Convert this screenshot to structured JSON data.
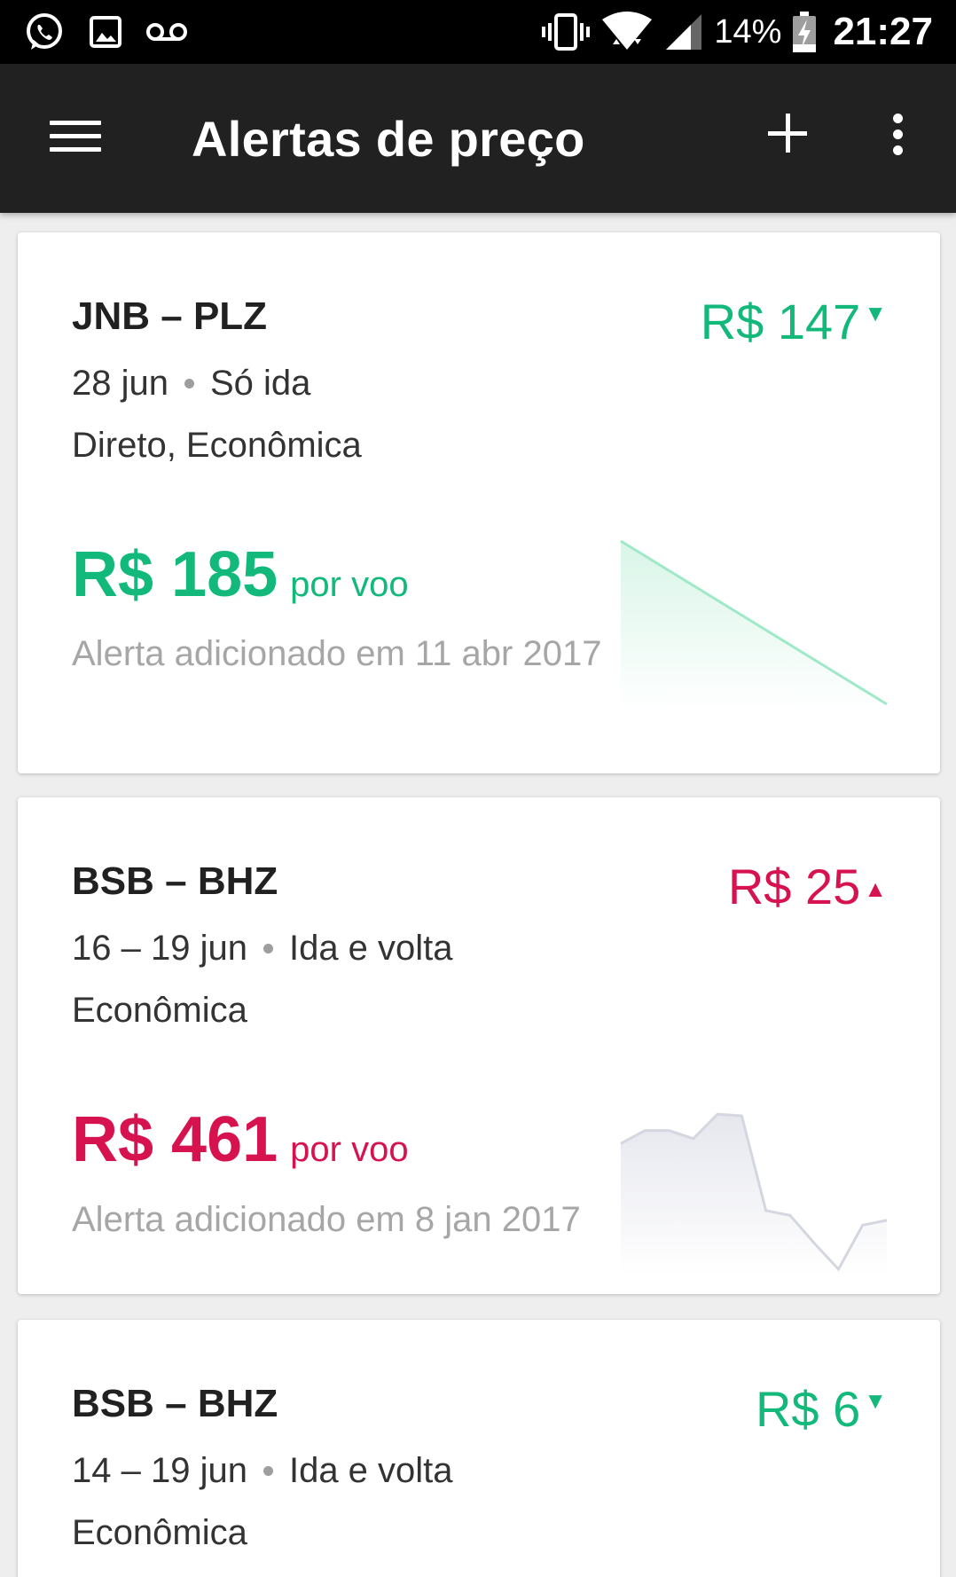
{
  "status_bar": {
    "icons": [
      "whatsapp-icon",
      "image-icon",
      "voicemail-icon",
      "vibrate-icon",
      "wifi-icon",
      "signal-icon",
      "battery-charging-icon"
    ],
    "battery": "14%",
    "time": "21:27"
  },
  "app_bar": {
    "title": "Alertas de preço",
    "icons": [
      "menu-icon",
      "add-icon",
      "more-vert-icon"
    ]
  },
  "colors": {
    "app_bar": "#212121",
    "price_down": "#12b97a",
    "price_up": "#d6134f",
    "trend_down_fill": "#d9f5e8",
    "trend_up_fill": "#e6e7ee",
    "muted_text": "#a6a6a6"
  },
  "alerts": [
    {
      "route": "JNB – PLZ",
      "dates": "28 jun",
      "trip_type": "Só ida",
      "details": "Direto, Econômica",
      "change": "R$ 147",
      "direction": "down",
      "direction_icon": "triangle-down-icon",
      "price": "R$ 185",
      "unit": "por voo",
      "added": "Alerta adicionado em 11 abr 2017",
      "trend": [
        1.0,
        0.0
      ]
    },
    {
      "route": "BSB – BHZ",
      "dates": "16 – 19 jun",
      "trip_type": "Ida e volta",
      "details": "Econômica",
      "change": "R$ 25",
      "direction": "up",
      "direction_icon": "triangle-up-icon",
      "price": "R$ 461",
      "unit": "por voo",
      "added": "Alerta adicionado em 8 jan 2017",
      "trend": [
        0.77,
        0.85,
        0.85,
        0.8,
        0.95,
        0.94,
        0.36,
        0.33,
        0.16,
        0.0,
        0.27,
        0.3
      ]
    },
    {
      "route": "BSB – BHZ",
      "dates": "14 – 19 jun",
      "trip_type": "Ida e volta",
      "details": "Econômica",
      "change": "R$ 6",
      "direction": "down",
      "direction_icon": "triangle-down-icon"
    }
  ]
}
